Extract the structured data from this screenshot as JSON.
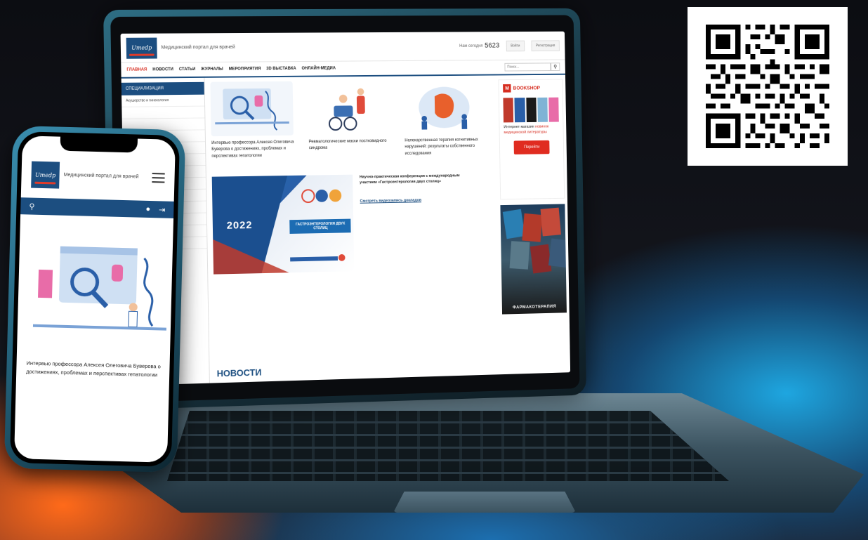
{
  "site": {
    "logo_text": "Umedp",
    "tagline": "Медицинский портал для врачей",
    "visitors_label": "Нам сегодня",
    "visitors_count": "5623",
    "header_btn_login": "Войти",
    "header_btn_register": "Регистрация",
    "nav": [
      "ГЛАВНАЯ",
      "НОВОСТИ",
      "СТАТЬИ",
      "ЖУРНАЛЫ",
      "МЕРОПРИЯТИЯ",
      "3D ВЫСТАВКА",
      "ОНЛАЙН-МЕДИА"
    ],
    "search_placeholder": "Поиск...",
    "search_icon": "search-icon",
    "sidebar_title": "СПЕЦИАЛИЗАЦИЯ",
    "sidebar_items": [
      "Акушерство и гинекология",
      "",
      "",
      "",
      "",
      "",
      "",
      "",
      "",
      "",
      "",
      "",
      "",
      ""
    ],
    "cards": [
      "Интервью профессора Алексея Олеговича Буверова о достижениях, проблемах и перспективах гепатологии",
      "Ревматологические маски постковидного синдрома",
      "Нелекарственная терапия когнитивных нарушений: результаты собственного исследования"
    ],
    "conference": {
      "year": "2022",
      "banner_title": "ГАСТРОЭНТЕРОЛОГИЯ ДВУХ СТОЛИЦ",
      "description": "Научно-практическая конференция с международным участием «Гастроэнтерология двух столиц»",
      "link": "Смотреть видеозапись докладов"
    },
    "news_heading": "НОВОСТИ",
    "bookshop": {
      "logo": "BOOKSHOP",
      "logo_letter": "M",
      "text_a": "Интернет магазин",
      "text_b": "новинок медицинской литературы",
      "button": "Перейти"
    },
    "pharma_ad_title": "ФАРМАКОТЕРАПИЯ"
  },
  "phone": {
    "logo_text": "Umedp",
    "tagline": "Медицинский портал для врачей",
    "menu_icon": "hamburger-menu-icon",
    "bar_icons": [
      "search-icon",
      "user-icon",
      "logout-icon"
    ],
    "caption": "Интервью профессора Алексея Олеговича Буверова о достижениях, проблемах и перспективах гепатологии"
  },
  "colors": {
    "brand": "#1c4e80",
    "accent": "#d62d20"
  }
}
